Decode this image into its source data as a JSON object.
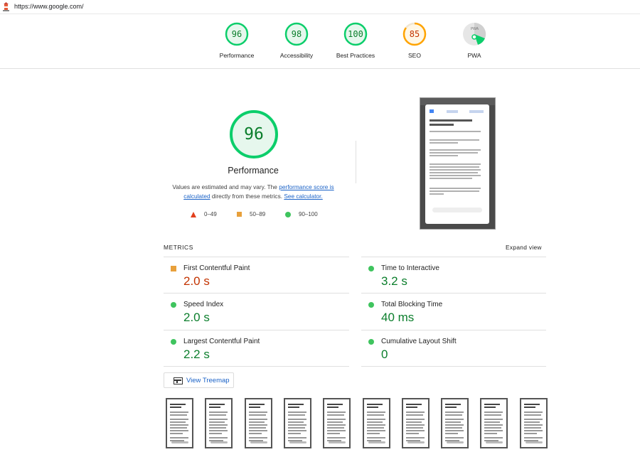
{
  "page": {
    "url": "https://www.google.com/"
  },
  "colors": {
    "green": "#0b7e2c",
    "green_ring": "#0cce6b",
    "orange": "#c33300",
    "orange_ring": "#ffa400",
    "red": "#e2401d",
    "link": "#1a62c7"
  },
  "header_scores": [
    {
      "label": "Performance",
      "score": "96",
      "status": "pass"
    },
    {
      "label": "Accessibility",
      "score": "98",
      "status": "pass"
    },
    {
      "label": "Best Practices",
      "score": "100",
      "status": "pass"
    },
    {
      "label": "SEO",
      "score": "85",
      "status": "average"
    },
    {
      "label": "PWA",
      "score": "",
      "status": "pwa",
      "icon": "pwa-badge-icon"
    }
  ],
  "performance": {
    "score": "96",
    "title": "Performance",
    "desc_prefix": "Values are estimated and may vary. The ",
    "desc_link1": "performance score is calculated",
    "desc_middle": " directly from these metrics. ",
    "desc_link2": "See calculator.",
    "legend": [
      {
        "icon": "red-triangle-icon",
        "range": "0–49"
      },
      {
        "icon": "orange-square-icon",
        "range": "50–89"
      },
      {
        "icon": "green-circle-icon",
        "range": "90–100"
      }
    ]
  },
  "metrics": {
    "section_label": "METRICS",
    "expand_label": "Expand view",
    "items": [
      {
        "name": "First Contentful Paint",
        "value": "2.0 s",
        "status": "average"
      },
      {
        "name": "Time to Interactive",
        "value": "3.2 s",
        "status": "pass"
      },
      {
        "name": "Speed Index",
        "value": "2.0 s",
        "status": "pass"
      },
      {
        "name": "Total Blocking Time",
        "value": "40 ms",
        "status": "pass"
      },
      {
        "name": "Largest Contentful Paint",
        "value": "2.2 s",
        "status": "pass"
      },
      {
        "name": "Cumulative Layout Shift",
        "value": "0",
        "status": "pass"
      }
    ]
  },
  "treemap": {
    "label": "View Treemap"
  },
  "filmstrip_count": 10
}
